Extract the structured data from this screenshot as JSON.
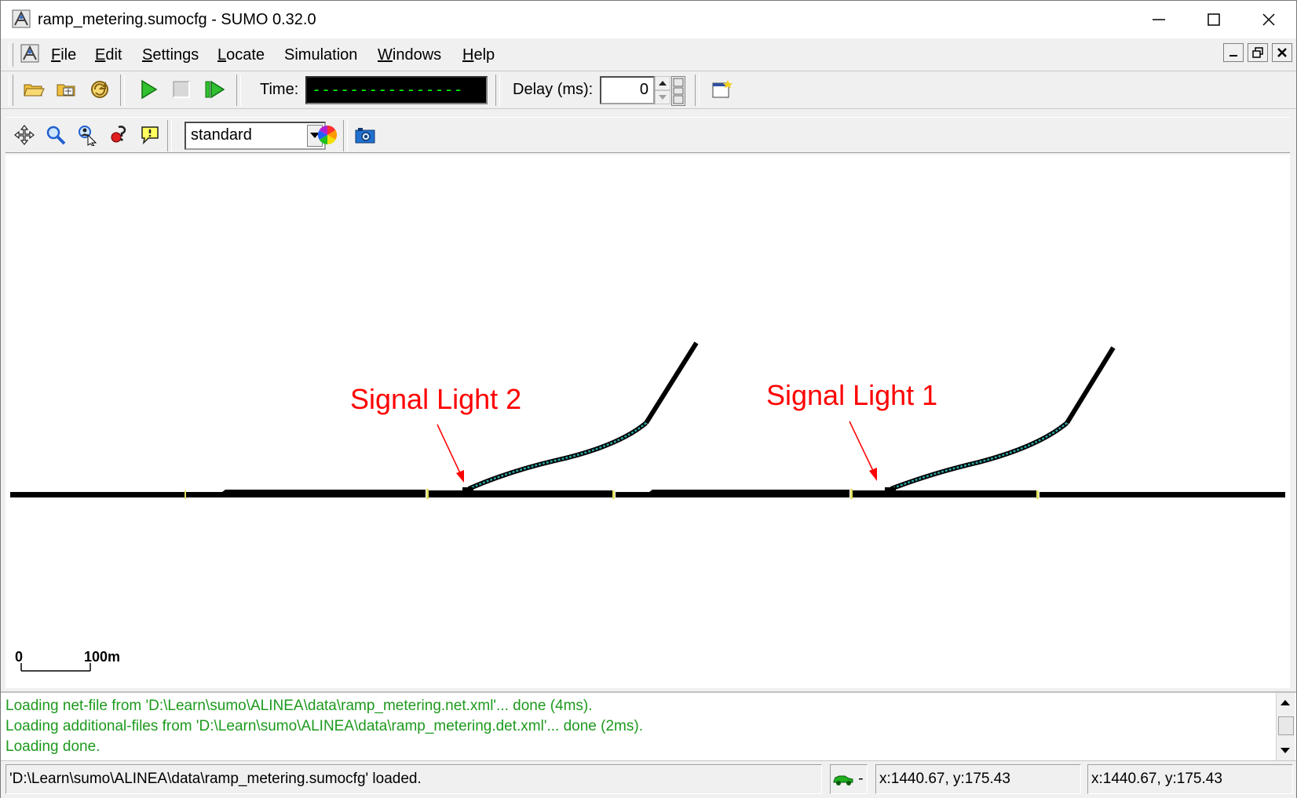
{
  "window": {
    "title": "ramp_metering.sumocfg - SUMO 0.32.0"
  },
  "menu": {
    "items": [
      {
        "label_pre": "",
        "accel": "F",
        "label_post": "ile"
      },
      {
        "label_pre": "",
        "accel": "E",
        "label_post": "dit"
      },
      {
        "label_pre": "",
        "accel": "S",
        "label_post": "ettings"
      },
      {
        "label_pre": "",
        "accel": "L",
        "label_post": "ocate"
      },
      {
        "label_pre": "Simulation",
        "accel": "",
        "label_post": ""
      },
      {
        "label_pre": "",
        "accel": "W",
        "label_post": "indows"
      },
      {
        "label_pre": "",
        "accel": "H",
        "label_post": "elp"
      }
    ]
  },
  "toolbar": {
    "time_label": "Time:",
    "time_value": "----------------",
    "delay_label": "Delay (ms):",
    "delay_value": "0"
  },
  "view_toolbar": {
    "scheme_value": "standard"
  },
  "canvas": {
    "annotations": [
      {
        "text": "Signal Light 2"
      },
      {
        "text": "Signal Light 1"
      }
    ],
    "scale_zero": "0",
    "scale_label": "100m"
  },
  "messages": [
    "Loading net-file from 'D:\\Learn\\sumo\\ALINEA\\data\\ramp_metering.net.xml'... done (4ms).",
    "Loading additional-files from 'D:\\Learn\\sumo\\ALINEA\\data\\ramp_metering.det.xml'... done (2ms).",
    "Loading done."
  ],
  "status": {
    "message": "'D:\\Learn\\sumo\\ALINEA\\data\\ramp_metering.sumocfg' loaded.",
    "vehicle_indicator": "-",
    "coords_1": "x:1440.67, y:175.43",
    "coords_2": "x:1440.67, y:175.43"
  },
  "colors": {
    "annotation": "#ff0000",
    "road": "#000000",
    "ramp_lane": "#2aa7a7",
    "message_text": "#1d9a1d",
    "time_digits": "#00ff00"
  }
}
